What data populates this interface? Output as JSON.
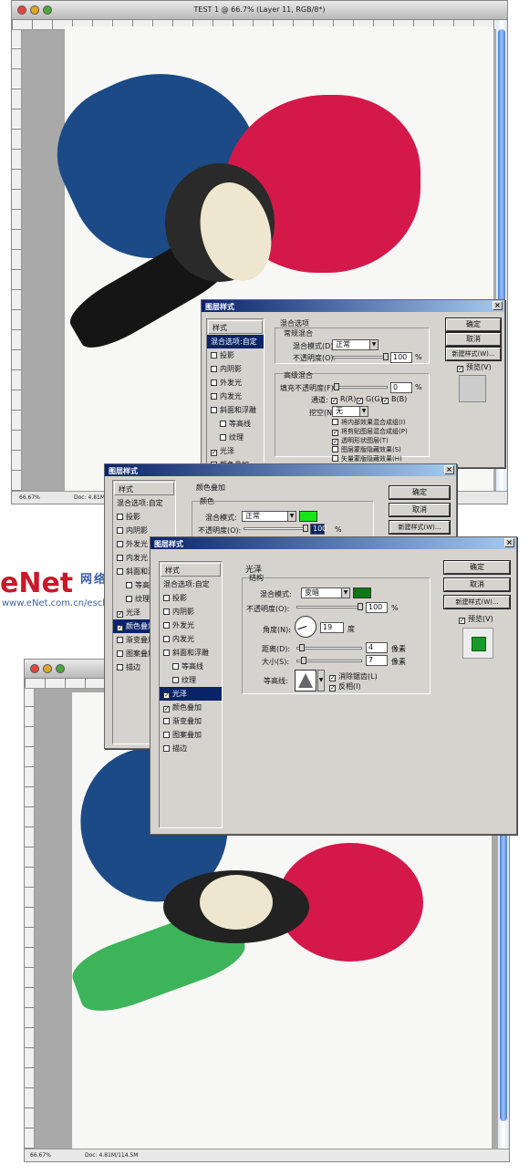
{
  "top_window": {
    "title": "TEST 1 @ 66.7% (Layer 11, RGB/8*)",
    "zoom": "66.67%",
    "doc_info": "Doc: 4.81M/..."
  },
  "bottom_window": {
    "zoom": "66.67%",
    "doc_info": "Doc: 4.81M/114.5M"
  },
  "watermark": {
    "logo": "eNet",
    "chinese": "网络学院",
    "url": "www.eNet.com.cn/eschool"
  },
  "dialog_blending": {
    "title": "图层样式",
    "list_header": "样式",
    "items": [
      {
        "label": "混合选项:自定",
        "selected": true,
        "checkbox": false
      },
      {
        "label": "投影",
        "checked": false,
        "checkbox": true
      },
      {
        "label": "内阴影",
        "checked": false,
        "checkbox": true
      },
      {
        "label": "外发光",
        "checked": false,
        "checkbox": true
      },
      {
        "label": "内发光",
        "checked": false,
        "checkbox": true
      },
      {
        "label": "斜面和浮雕",
        "checked": false,
        "checkbox": true
      },
      {
        "label": "等高线",
        "checked": false,
        "checkbox": true,
        "indent": true
      },
      {
        "label": "纹理",
        "checked": false,
        "checkbox": true,
        "indent": true
      },
      {
        "label": "光泽",
        "checked": true,
        "checkbox": true
      },
      {
        "label": "颜色叠加",
        "checked": false,
        "checkbox": true
      },
      {
        "label": "渐变叠加",
        "checked": false,
        "checkbox": true
      }
    ],
    "section_title": "混合选项",
    "normal_title": "常规混合",
    "blend_mode_label": "混合模式(D):",
    "blend_mode_value": "正常",
    "opacity_label": "不透明度(O):",
    "opacity_value": "100",
    "pct": "%",
    "advanced_title": "高级混合",
    "fill_label": "填充不透明度(F):",
    "fill_value": "0",
    "channels_label": "通道:",
    "channels": [
      "R(R)",
      "G(G)",
      "B(B)"
    ],
    "knockout_label": "挖空(N):",
    "knockout_value": "无",
    "options": [
      {
        "label": "将内部效果混合成组(I)",
        "checked": false
      },
      {
        "label": "将剪贴图层混合成组(P)",
        "checked": true
      },
      {
        "label": "透明形状图层(T)",
        "checked": true
      },
      {
        "label": "图层蒙版隐藏效果(S)",
        "checked": false
      },
      {
        "label": "矢量蒙版隐藏效果(H)",
        "checked": false
      }
    ],
    "ok": "确定",
    "cancel": "取消",
    "new_style": "新建样式(W)...",
    "preview": "预览(V)"
  },
  "dialog_color": {
    "title": "图层样式",
    "list_header": "样式",
    "items": [
      {
        "label": "混合选项:自定",
        "checkbox": false
      },
      {
        "label": "投影",
        "checked": false,
        "checkbox": true
      },
      {
        "label": "内阴影",
        "checked": false,
        "checkbox": true
      },
      {
        "label": "外发光",
        "checked": false,
        "checkbox": true
      },
      {
        "label": "内发光",
        "checked": false,
        "checkbox": true
      },
      {
        "label": "斜面和浮雕",
        "checked": false,
        "checkbox": true
      },
      {
        "label": "等高线",
        "checked": false,
        "checkbox": true,
        "indent": true
      },
      {
        "label": "纹理",
        "checked": false,
        "checkbox": true,
        "indent": true
      },
      {
        "label": "光泽",
        "checked": true,
        "checkbox": true
      },
      {
        "label": "颜色叠加",
        "checked": true,
        "checkbox": true,
        "selected": true
      },
      {
        "label": "渐变叠加",
        "checked": false,
        "checkbox": true
      },
      {
        "label": "图案叠加",
        "checked": false,
        "checkbox": true
      },
      {
        "label": "描边",
        "checked": false,
        "checkbox": true
      }
    ],
    "section_title": "颜色叠加",
    "sub_title": "颜色",
    "blend_mode_label": "混合模式:",
    "blend_mode_value": "正常",
    "color": "#16e616",
    "opacity_label": "不透明度(O):",
    "opacity_value": "100",
    "pct": "%",
    "ok": "确定",
    "cancel": "取消",
    "new_style": "新建样式(W)..."
  },
  "dialog_satin": {
    "title": "图层样式",
    "list_header": "样式",
    "items": [
      {
        "label": "混合选项:自定",
        "checkbox": false
      },
      {
        "label": "投影",
        "checked": false,
        "checkbox": true
      },
      {
        "label": "内阴影",
        "checked": false,
        "checkbox": true
      },
      {
        "label": "外发光",
        "checked": false,
        "checkbox": true
      },
      {
        "label": "内发光",
        "checked": false,
        "checkbox": true
      },
      {
        "label": "斜面和浮雕",
        "checked": false,
        "checkbox": true
      },
      {
        "label": "等高线",
        "checked": false,
        "checkbox": true,
        "indent": true
      },
      {
        "label": "纹理",
        "checked": false,
        "checkbox": true,
        "indent": true
      },
      {
        "label": "光泽",
        "checked": true,
        "checkbox": true,
        "selected": true
      },
      {
        "label": "颜色叠加",
        "checked": true,
        "checkbox": true
      },
      {
        "label": "渐变叠加",
        "checked": false,
        "checkbox": true
      },
      {
        "label": "图案叠加",
        "checked": false,
        "checkbox": true
      },
      {
        "label": "描边",
        "checked": false,
        "checkbox": true
      }
    ],
    "section_title": "光泽",
    "sub_title": "结构",
    "blend_mode_label": "混合模式:",
    "blend_mode_value": "变暗",
    "color": "#0c7a14",
    "opacity_label": "不透明度(O):",
    "opacity_value": "100",
    "pct": "%",
    "angle_label": "角度(N):",
    "angle_value": "19",
    "angle_unit": "度",
    "distance_label": "距离(D):",
    "distance_value": "4",
    "size_label": "大小(S):",
    "size_value": "7",
    "px_unit": "像素",
    "contour_label": "等高线:",
    "antialias_label": "消除锯齿(L)",
    "invert_label": "反相(I)",
    "ok": "确定",
    "cancel": "取消",
    "new_style": "新建样式(W)...",
    "preview": "预览(V)",
    "preview_color": "#1a9a2a"
  }
}
